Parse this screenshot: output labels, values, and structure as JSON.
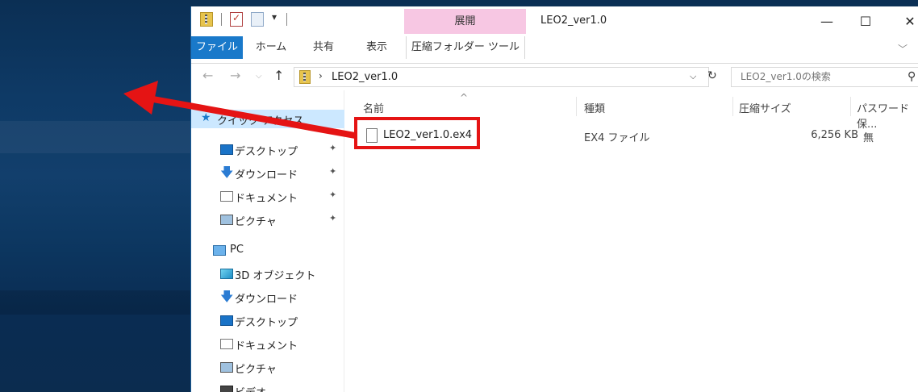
{
  "quick_access_toolbar": {
    "icons": [
      "zip-folder-icon",
      "properties-icon",
      "new-folder-icon"
    ],
    "dropdown": "▾"
  },
  "contextual_tab_header": "展開",
  "window": {
    "title": "LEO2_ver1.0",
    "minimize": "—",
    "maximize": "☐",
    "close": "✕"
  },
  "ribbon": {
    "tabs": [
      "ファイル",
      "ホーム",
      "共有",
      "表示",
      "圧縮フォルダー ツール"
    ],
    "expand": "﹀"
  },
  "address_bar": {
    "back": "←",
    "forward": "→",
    "recent": "⌵",
    "up": "↑",
    "chevron": "›",
    "path": "LEO2_ver1.0",
    "dropdown": "⌵",
    "refresh": "↻"
  },
  "search": {
    "placeholder": "LEO2_ver1.0の検索",
    "icon": "⚲"
  },
  "nav_pane": {
    "quick_access": "クイック アクセス",
    "pinned": [
      {
        "label": "デスクトップ",
        "icon": "desktop-icon"
      },
      {
        "label": "ダウンロード",
        "icon": "download-icon"
      },
      {
        "label": "ドキュメント",
        "icon": "documents-icon"
      },
      {
        "label": "ピクチャ",
        "icon": "pictures-icon"
      }
    ],
    "pin_glyph": "📌",
    "pc": "PC",
    "pc_items": [
      {
        "label": "3D オブジェクト",
        "icon": "3d-objects-icon"
      },
      {
        "label": "ダウンロード",
        "icon": "download-icon"
      },
      {
        "label": "デスクトップ",
        "icon": "desktop-icon"
      },
      {
        "label": "ドキュメント",
        "icon": "documents-icon"
      },
      {
        "label": "ピクチャ",
        "icon": "pictures-icon"
      },
      {
        "label": "ビデオ",
        "icon": "videos-icon"
      }
    ]
  },
  "file_list": {
    "columns": {
      "name": "名前",
      "type": "種類",
      "compressed_size": "圧縮サイズ",
      "password": "パスワード保..."
    },
    "sort_indicator": "^",
    "rows": [
      {
        "name": "LEO2_ver1.0.ex4",
        "type": "EX4 ファイル",
        "size": "6,256 KB",
        "password": "無"
      }
    ]
  },
  "annotation": {
    "arrow_color": "#e51414",
    "box_color": "#e51414"
  }
}
